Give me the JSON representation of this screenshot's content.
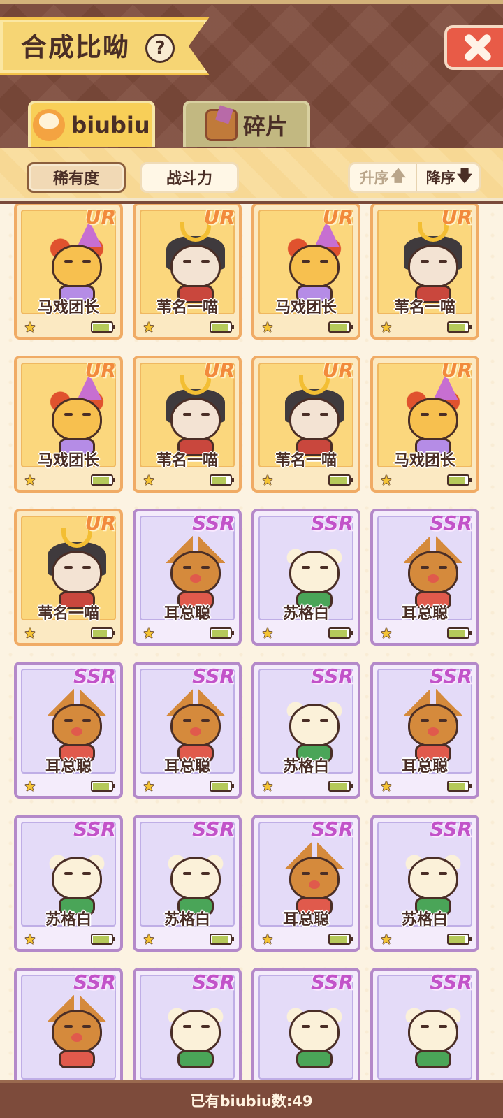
{
  "header": {
    "title": "合成比呦",
    "help_label": "?"
  },
  "tabs": [
    {
      "label": "biubiu",
      "active": true
    },
    {
      "label": "碎片",
      "active": false
    }
  ],
  "sort": {
    "rarity_label": "稀有度",
    "power_label": "战斗力",
    "asc_label": "升序",
    "desc_label": "降序",
    "asc_arrow": "🡅",
    "desc_arrow": "🡇"
  },
  "colors": {
    "ur_accent": "#f28a3c",
    "ssr_accent": "#c253c9"
  },
  "cards": [
    {
      "rarity": "UR",
      "name": "马戏团长",
      "char": "circus",
      "stars": 1,
      "energy": 0.9
    },
    {
      "rarity": "UR",
      "name": "苇名一喵",
      "char": "samurai",
      "stars": 1,
      "energy": 0.9
    },
    {
      "rarity": "UR",
      "name": "马戏团长",
      "char": "circus",
      "stars": 1,
      "energy": 0.9
    },
    {
      "rarity": "UR",
      "name": "苇名一喵",
      "char": "samurai",
      "stars": 1,
      "energy": 0.9
    },
    {
      "rarity": "UR",
      "name": "马戏团长",
      "char": "circus",
      "stars": 1,
      "energy": 0.9
    },
    {
      "rarity": "UR",
      "name": "苇名一喵",
      "char": "samurai",
      "stars": 1,
      "energy": 0.75
    },
    {
      "rarity": "UR",
      "name": "苇名一喵",
      "char": "samurai",
      "stars": 1,
      "energy": 0.9
    },
    {
      "rarity": "UR",
      "name": "马戏团长",
      "char": "circus",
      "stars": 1,
      "energy": 0.9
    },
    {
      "rarity": "UR",
      "name": "苇名一喵",
      "char": "samurai",
      "stars": 1,
      "energy": 0.75
    },
    {
      "rarity": "SSR",
      "name": "耳总聪",
      "char": "serval",
      "stars": 1,
      "energy": 0.9
    },
    {
      "rarity": "SSR",
      "name": "苏格白",
      "char": "scottish",
      "stars": 1,
      "energy": 0.9
    },
    {
      "rarity": "SSR",
      "name": "耳总聪",
      "char": "serval",
      "stars": 1,
      "energy": 0.9
    },
    {
      "rarity": "SSR",
      "name": "耳总聪",
      "char": "serval",
      "stars": 1,
      "energy": 0.9
    },
    {
      "rarity": "SSR",
      "name": "耳总聪",
      "char": "serval",
      "stars": 1,
      "energy": 0.9
    },
    {
      "rarity": "SSR",
      "name": "苏格白",
      "char": "scottish",
      "stars": 1,
      "energy": 0.9
    },
    {
      "rarity": "SSR",
      "name": "耳总聪",
      "char": "serval",
      "stars": 1,
      "energy": 0.9
    },
    {
      "rarity": "SSR",
      "name": "苏格白",
      "char": "scottish",
      "stars": 1,
      "energy": 0.9
    },
    {
      "rarity": "SSR",
      "name": "苏格白",
      "char": "scottish",
      "stars": 1,
      "energy": 0.9
    },
    {
      "rarity": "SSR",
      "name": "耳总聪",
      "char": "serval",
      "stars": 1,
      "energy": 0.9
    },
    {
      "rarity": "SSR",
      "name": "苏格白",
      "char": "scottish",
      "stars": 1,
      "energy": 0.9
    },
    {
      "rarity": "SSR",
      "name": "",
      "char": "serval",
      "stars": 1,
      "energy": 0.9
    },
    {
      "rarity": "SSR",
      "name": "",
      "char": "scottish",
      "stars": 1,
      "energy": 0.9
    },
    {
      "rarity": "SSR",
      "name": "",
      "char": "scottish",
      "stars": 1,
      "energy": 0.9
    },
    {
      "rarity": "SSR",
      "name": "",
      "char": "scottish",
      "stars": 1,
      "energy": 0.9
    }
  ],
  "footer": {
    "count_text": "已有biubiu数:49"
  }
}
